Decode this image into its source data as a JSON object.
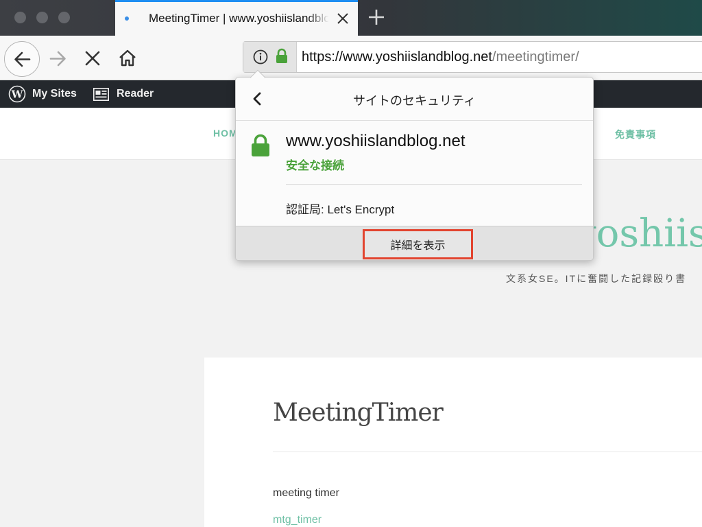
{
  "browser": {
    "tab": {
      "title": "MeetingTimer | www.yoshiislandblog.net"
    },
    "url": {
      "host": "https://www.yoshiislandblog.net",
      "path": "/meetingtimer/"
    }
  },
  "wp_admin_bar": {
    "my_sites": "My Sites",
    "reader": "Reader"
  },
  "site": {
    "menu": {
      "home": "HOM",
      "disclaimer": "免責事項"
    },
    "brand": "yoshiisl",
    "tagline": "文系女SE。ITに奮闘した記録殴り書"
  },
  "article": {
    "title": "MeetingTimer",
    "text": "meeting timer",
    "link": "mtg_timer"
  },
  "security_popup": {
    "title": "サイトのセキュリティ",
    "host": "www.yoshiislandblog.net",
    "status": "安全な接続",
    "ca": "認証局: Let's Encrypt",
    "more_button": "詳細を表示"
  },
  "colors": {
    "accent_green": "#4aa23a",
    "site_accent": "#6fc0a5",
    "highlight_red": "#e2442f",
    "tab_indicator": "#1e8ef2"
  },
  "icons": {
    "back": "arrow-left-icon",
    "forward": "arrow-right-icon",
    "stop": "close-icon",
    "home": "home-icon",
    "info": "info-icon",
    "lock": "lock-icon",
    "wordpress": "wordpress-icon",
    "reader": "reader-icon"
  }
}
